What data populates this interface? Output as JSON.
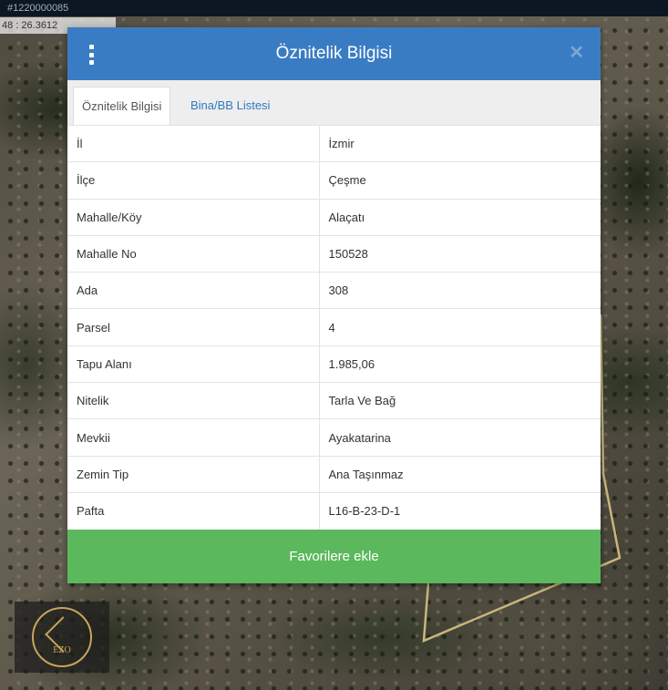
{
  "top_bar": {
    "id_text": "#1220000085"
  },
  "coordinates": {
    "text": "48 : 26.3612"
  },
  "dialog": {
    "title": "Öznitelik Bilgisi",
    "menu_icon": "vertical-dots-icon",
    "close_icon": "close-icon",
    "tabs": [
      {
        "label": "Öznitelik Bilgisi",
        "active": true
      },
      {
        "label": "Bina/BB Listesi",
        "active": false
      }
    ],
    "rows": [
      {
        "key": "İl",
        "value": "İzmir"
      },
      {
        "key": "İlçe",
        "value": "Çeşme"
      },
      {
        "key": "Mahalle/Köy",
        "value": "Alaçatı"
      },
      {
        "key": "Mahalle No",
        "value": "150528"
      },
      {
        "key": "Ada",
        "value": "308"
      },
      {
        "key": "Parsel",
        "value": "4"
      },
      {
        "key": "Tapu Alanı",
        "value": "1.985,06"
      },
      {
        "key": "Nitelik",
        "value": "Tarla Ve Bağ"
      },
      {
        "key": "Mevkii",
        "value": "Ayakatarina"
      },
      {
        "key": "Zemin Tip",
        "value": "Ana Taşınmaz"
      },
      {
        "key": "Pafta",
        "value": "L16-B-23-D-1"
      }
    ],
    "favorite_button": "Favorilere ekle"
  },
  "logo": {
    "text": "EZO"
  },
  "colors": {
    "header": "#3a7cc3",
    "button": "#5cb85c",
    "tab_link": "#2f78c0",
    "parcel_outline": "#c8b77a"
  }
}
